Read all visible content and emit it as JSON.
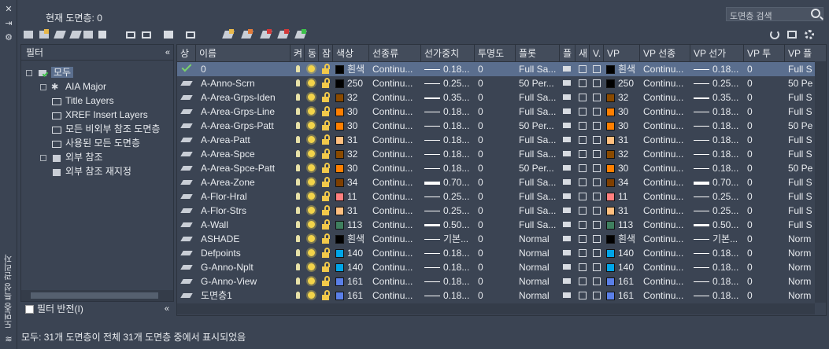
{
  "side_title": "도면층 특성 관리자",
  "current_layer": "현재 도면층: 0",
  "search_placeholder": "도면층 검색",
  "filter_header": "필터",
  "invert_filter": "필터 반전(I)",
  "tree": [
    {
      "label": "모두",
      "selected": true
    },
    {
      "label": "AIA Major"
    },
    {
      "label": "Title Layers"
    },
    {
      "label": "XREF Insert Layers"
    },
    {
      "label": "모든 비외부 참조 도면층"
    },
    {
      "label": "사용된 모든 도면층"
    },
    {
      "label": "외부 참조"
    },
    {
      "label": "외부 참조 재지정"
    }
  ],
  "columns": [
    "상",
    "이름",
    "켜",
    "동",
    "잠",
    "색상",
    "선종류",
    "선가중치",
    "투명도",
    "플롯",
    "플",
    "새",
    "V.",
    "VP",
    "VP 선종",
    "VP 선가",
    "VP 투",
    "VP 플"
  ],
  "rows": [
    {
      "name": "0",
      "color_hex": "#000000",
      "color": "흰색",
      "ltype": "Continu...",
      "lweight": "0.18...",
      "trans": "0",
      "plot": "Full Sa...",
      "vpcolor_hex": "#000000",
      "vpcolor": "흰색",
      "vpltype": "Continu...",
      "vplw": "0.18...",
      "vptrans": "0",
      "vpplot": "Full S"
    },
    {
      "name": "A-Anno-Scrn",
      "color_hex": "#000000",
      "color": "250",
      "ltype": "Continu...",
      "lweight": "0.25...",
      "trans": "0",
      "plot": "50 Per...",
      "vpcolor_hex": "#000000",
      "vpcolor": "250",
      "vpltype": "Continu...",
      "vplw": "0.25...",
      "vptrans": "0",
      "vpplot": "50 Pe"
    },
    {
      "name": "A-Area-Grps-Iden",
      "color_hex": "#8a4a00",
      "color": "32",
      "ltype": "Continu...",
      "lweight": "0.35...",
      "trans": "0",
      "plot": "Full Sa...",
      "vpcolor_hex": "#8a4a00",
      "vpcolor": "32",
      "vpltype": "Continu...",
      "vplw": "0.35...",
      "vptrans": "0",
      "vpplot": "Full S"
    },
    {
      "name": "A-Area-Grps-Line",
      "color_hex": "#ff7f00",
      "color": "30",
      "ltype": "Continu...",
      "lweight": "0.18...",
      "trans": "0",
      "plot": "Full Sa...",
      "vpcolor_hex": "#ff7f00",
      "vpcolor": "30",
      "vpltype": "Continu...",
      "vplw": "0.18...",
      "vptrans": "0",
      "vpplot": "Full S"
    },
    {
      "name": "A-Area-Grps-Patt",
      "color_hex": "#ff7f00",
      "color": "30",
      "ltype": "Continu...",
      "lweight": "0.18...",
      "trans": "0",
      "plot": "50 Per...",
      "vpcolor_hex": "#ff7f00",
      "vpcolor": "30",
      "vpltype": "Continu...",
      "vplw": "0.18...",
      "vptrans": "0",
      "vpplot": "50 Pe"
    },
    {
      "name": "A-Area-Patt",
      "color_hex": "#ffbf7f",
      "color": "31",
      "ltype": "Continu...",
      "lweight": "0.18...",
      "trans": "0",
      "plot": "Full Sa...",
      "vpcolor_hex": "#ffbf7f",
      "vpcolor": "31",
      "vpltype": "Continu...",
      "vplw": "0.18...",
      "vptrans": "0",
      "vpplot": "Full S"
    },
    {
      "name": "A-Area-Spce",
      "color_hex": "#8a4a00",
      "color": "32",
      "ltype": "Continu...",
      "lweight": "0.18...",
      "trans": "0",
      "plot": "Full Sa...",
      "vpcolor_hex": "#8a4a00",
      "vpcolor": "32",
      "vpltype": "Continu...",
      "vplw": "0.18...",
      "vptrans": "0",
      "vpplot": "Full S"
    },
    {
      "name": "A-Area-Spce-Patt",
      "color_hex": "#ff7f00",
      "color": "30",
      "ltype": "Continu...",
      "lweight": "0.18...",
      "trans": "0",
      "plot": "50 Per...",
      "vpcolor_hex": "#ff7f00",
      "vpcolor": "30",
      "vpltype": "Continu...",
      "vplw": "0.18...",
      "vptrans": "0",
      "vpplot": "50 Pe"
    },
    {
      "name": "A-Area-Zone",
      "color_hex": "#7f3f00",
      "color": "34",
      "ltype": "Continu...",
      "lweight": "0.70...",
      "trans": "0",
      "plot": "Full Sa...",
      "vpcolor_hex": "#7f3f00",
      "vpcolor": "34",
      "vpltype": "Continu...",
      "vplw": "0.70...",
      "vptrans": "0",
      "vpplot": "Full S"
    },
    {
      "name": "A-Flor-Hral",
      "color_hex": "#ff7f7f",
      "color": "11",
      "ltype": "Continu...",
      "lweight": "0.25...",
      "trans": "0",
      "plot": "Full Sa...",
      "vpcolor_hex": "#ff7f7f",
      "vpcolor": "11",
      "vpltype": "Continu...",
      "vplw": "0.25...",
      "vptrans": "0",
      "vpplot": "Full S"
    },
    {
      "name": "A-Flor-Strs",
      "color_hex": "#ffbf7f",
      "color": "31",
      "ltype": "Continu...",
      "lweight": "0.25...",
      "trans": "0",
      "plot": "Full Sa...",
      "vpcolor_hex": "#ffbf7f",
      "vpcolor": "31",
      "vpltype": "Continu...",
      "vplw": "0.25...",
      "vptrans": "0",
      "vpplot": "Full S"
    },
    {
      "name": "A-Wall",
      "color_hex": "#3f7f5f",
      "color": "113",
      "ltype": "Continu...",
      "lweight": "0.50...",
      "trans": "0",
      "plot": "Full Sa...",
      "vpcolor_hex": "#3f7f5f",
      "vpcolor": "113",
      "vpltype": "Continu...",
      "vplw": "0.50...",
      "vptrans": "0",
      "vpplot": "Full S"
    },
    {
      "name": "ASHADE",
      "color_hex": "#000000",
      "color": "흰색",
      "ltype": "Continu...",
      "lweight": "기본...",
      "trans": "0",
      "plot": "Normal",
      "vpcolor_hex": "#000000",
      "vpcolor": "흰색",
      "vpltype": "Continu...",
      "vplw": "기본...",
      "vptrans": "0",
      "vpplot": "Norm"
    },
    {
      "name": "Defpoints",
      "color_hex": "#00a5e8",
      "color": "140",
      "ltype": "Continu...",
      "lweight": "0.18...",
      "trans": "0",
      "plot": "Normal",
      "vpcolor_hex": "#00a5e8",
      "vpcolor": "140",
      "vpltype": "Continu...",
      "vplw": "0.18...",
      "vptrans": "0",
      "vpplot": "Norm"
    },
    {
      "name": "G-Anno-Nplt",
      "color_hex": "#00a5e8",
      "color": "140",
      "ltype": "Continu...",
      "lweight": "0.18...",
      "trans": "0",
      "plot": "Normal",
      "vpcolor_hex": "#00a5e8",
      "vpcolor": "140",
      "vpltype": "Continu...",
      "vplw": "0.18...",
      "vptrans": "0",
      "vpplot": "Norm"
    },
    {
      "name": "G-Anno-View",
      "color_hex": "#5a7fe8",
      "color": "161",
      "ltype": "Continu...",
      "lweight": "0.18...",
      "trans": "0",
      "plot": "Normal",
      "vpcolor_hex": "#5a7fe8",
      "vpcolor": "161",
      "vpltype": "Continu...",
      "vplw": "0.18...",
      "vptrans": "0",
      "vpplot": "Norm"
    },
    {
      "name": "도면층1",
      "color_hex": "#5a7fe8",
      "color": "161",
      "ltype": "Continu...",
      "lweight": "0.18...",
      "trans": "0",
      "plot": "Normal",
      "vpcolor_hex": "#5a7fe8",
      "vpcolor": "161",
      "vpltype": "Continu...",
      "vplw": "0.18...",
      "vptrans": "0",
      "vpplot": "Norm"
    }
  ],
  "status_text": "모두: 31개 도면층이 전체 31개 도면층 중에서 표시되었음"
}
